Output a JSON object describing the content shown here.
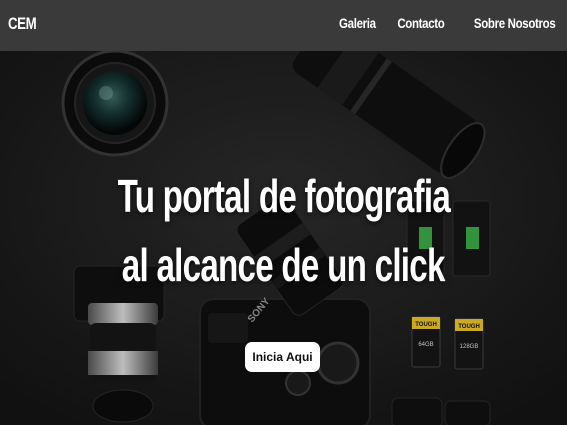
{
  "nav": {
    "brand": "CEM",
    "links": [
      "Galeria",
      "Contacto",
      "Sobre Nosotros"
    ]
  },
  "hero": {
    "headline_line1": "Tu portal de fotografia",
    "headline_line2": "al alcance de un click",
    "cta_label": "Inicia Aqui",
    "memory_card_1": "TOUGH",
    "memory_card_2": "TOUGH",
    "memory_card_1_size": "64GB",
    "memory_card_2_size": "128GB",
    "camera_brand": "SONY"
  },
  "colors": {
    "navbar_bg": "#3a3a3a",
    "hero_bg": "#202020",
    "card_yellow": "#e6c229",
    "battery_green": "#39a845"
  }
}
